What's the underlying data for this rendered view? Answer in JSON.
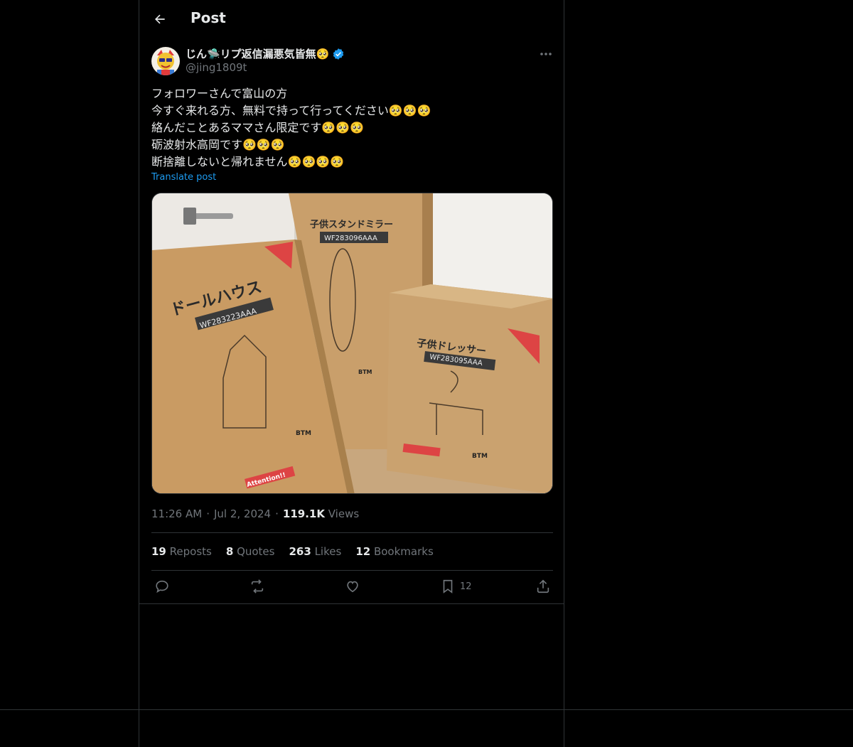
{
  "header": {
    "title": "Post"
  },
  "post": {
    "author_name": "じん🛸リプ返信漏悪気皆無🥺",
    "author_handle": "@jing1809t",
    "lines": [
      "フォロワーさんで富山の方",
      "今すぐ来れる方、無料で持って行ってください🥺🥺🥺",
      "絡んだことあるママさん限定です🥺🥺🥺",
      "砺波射水高岡です🥺🥺🥺",
      "断捨離しないと帰れません🥺🥺🥺🥺"
    ],
    "translate_label": "Translate post",
    "time": "11:26 AM",
    "date": "Jul 2, 2024",
    "views_count": "119.1K",
    "views_label": "Views",
    "sep": "·"
  },
  "photo": {
    "box1_title": "ドールハウス",
    "box1_code": "WF283223AAA",
    "box2_title": "子供スタンドミラー",
    "box2_code": "WF283096AAA",
    "box3_title": "子供ドレッサー",
    "box3_code": "WF283095AAA",
    "brand": "BTM",
    "attention": "Attention!!"
  },
  "stats": {
    "reposts_count": "19",
    "reposts_label": "Reposts",
    "quotes_count": "8",
    "quotes_label": "Quotes",
    "likes_count": "263",
    "likes_label": "Likes",
    "bookmarks_count": "12",
    "bookmarks_label": "Bookmarks"
  },
  "actions": {
    "bookmark_count": "12"
  },
  "colors": {
    "accent": "#1d9bf0",
    "background": "#000000",
    "muted": "#71767b",
    "text": "#e7e9ea",
    "border": "#2f3336"
  }
}
